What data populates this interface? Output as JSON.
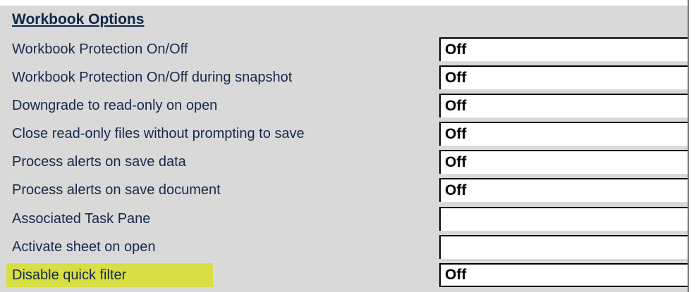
{
  "workbook_options": {
    "title": "Workbook Options",
    "rows": [
      {
        "label": "Workbook Protection On/Off",
        "value": "Off"
      },
      {
        "label": "Workbook Protection On/Off during snapshot",
        "value": "Off"
      },
      {
        "label": "Downgrade to read-only on open",
        "value": "Off"
      },
      {
        "label": "Close read-only files without prompting to save",
        "value": "Off"
      },
      {
        "label": "Process alerts on save data",
        "value": "Off"
      },
      {
        "label": "Process alerts on save document",
        "value": "Off"
      },
      {
        "label": "Associated Task Pane",
        "value": ""
      },
      {
        "label": "Activate sheet on open",
        "value": ""
      },
      {
        "label": "Disable quick filter",
        "value": "Off"
      }
    ]
  },
  "colors": {
    "background": "#d9d9d9",
    "label_text": "#152a49",
    "highlight": "#d7df45",
    "value_text": "#000000",
    "cell_background": "#ffffff",
    "cell_border": "#000000"
  }
}
